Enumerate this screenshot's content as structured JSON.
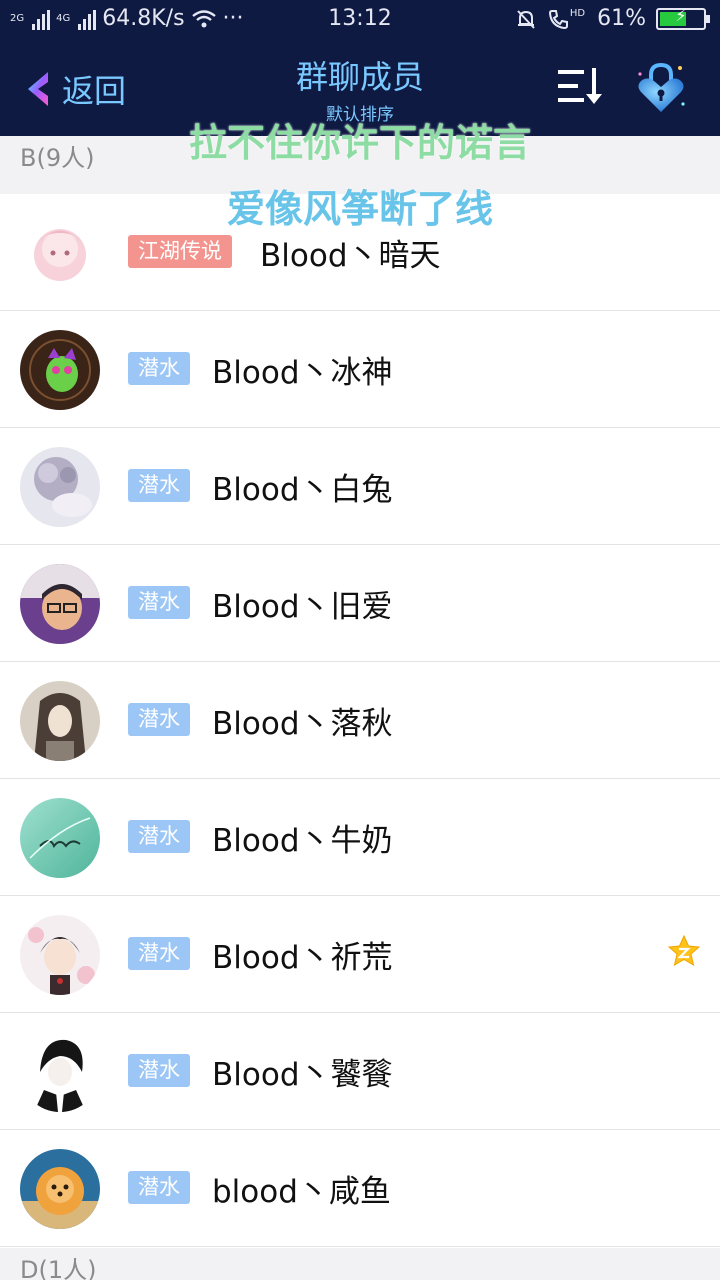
{
  "status_bar": {
    "net_label_1": "2G",
    "net_label_2": "4G",
    "speed": "64.8K/s",
    "more": "···",
    "time": "13:12",
    "hd": "HD",
    "battery": "61%",
    "battery_level": 0.61
  },
  "nav": {
    "back_label": "返回",
    "title": "群聊成员",
    "subtitle": "默认排序"
  },
  "overlay": {
    "line1": "拉不住你许下的诺言",
    "line2": "爱像风筝断了线"
  },
  "sections": [
    {
      "header": "B(9人)"
    },
    {
      "header": "D(1人)"
    }
  ],
  "members": [
    {
      "badge": "江湖传说",
      "badge_type": "legend",
      "name": "Blood丶暗天"
    },
    {
      "badge": "潜水",
      "badge_type": "dive",
      "name": "Blood丶冰神"
    },
    {
      "badge": "潜水",
      "badge_type": "dive",
      "name": "Blood丶白兔"
    },
    {
      "badge": "潜水",
      "badge_type": "dive",
      "name": "Blood丶旧爱"
    },
    {
      "badge": "潜水",
      "badge_type": "dive",
      "name": "Blood丶落秋"
    },
    {
      "badge": "潜水",
      "badge_type": "dive",
      "name": "Blood丶牛奶"
    },
    {
      "badge": "潜水",
      "badge_type": "dive",
      "name": "Blood丶祈荒",
      "star_icon": "vip-star-icon"
    },
    {
      "badge": "潜水",
      "badge_type": "dive",
      "name": "Blood丶饕餮"
    },
    {
      "badge": "潜水",
      "badge_type": "dive",
      "name": "blood丶咸鱼"
    }
  ],
  "colors": {
    "nav_bg": "#0f1a43",
    "nav_text": "#79c8ff",
    "badge_dive": "#9cc6f5",
    "badge_legend": "#f3948e",
    "lyric_line1": "#8ddca3",
    "lyric_line2": "#68c4e8"
  }
}
